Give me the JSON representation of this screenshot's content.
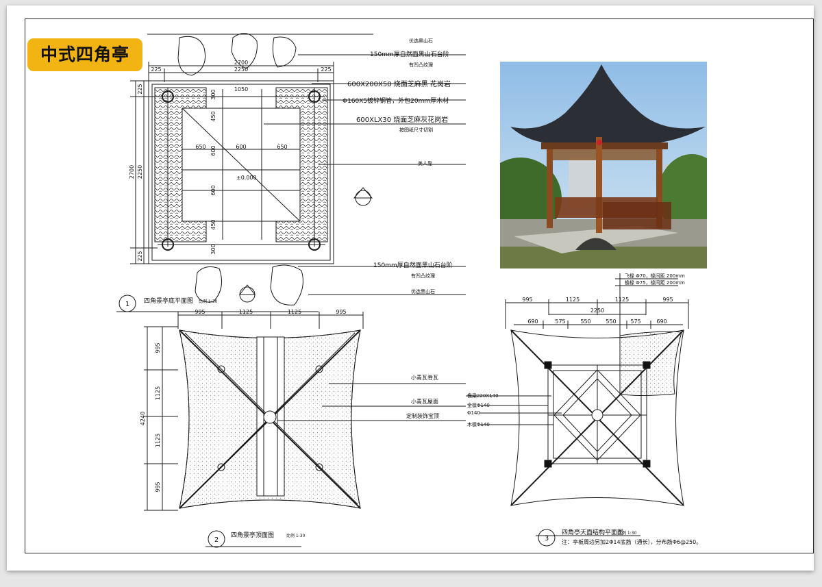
{
  "title": "中式四角亭",
  "plan1": {
    "num": "1",
    "caption": "四角景亭底平面图",
    "scale": "比例 1:30",
    "dims_top": [
      "225",
      "2250",
      "225"
    ],
    "dim_top_total": "2700",
    "dims_inner_top": [
      "1050"
    ],
    "dims_row": [
      "650",
      "600",
      "650"
    ],
    "dims_left": [
      "225",
      "2250",
      "225"
    ],
    "dim_left_total": "2700",
    "dims_vert": [
      "300",
      "450",
      "600",
      "600",
      "450",
      "300"
    ],
    "level": "±0.000",
    "notes": [
      {
        "text": "优选黑山石",
        "large": false
      },
      {
        "text": "150mm厚自然面黑山石台阶",
        "large": true
      },
      {
        "text": "有凹凸纹理",
        "large": false
      },
      {
        "text": "600X200X50 烧面芝麻黑 花岗岩",
        "large": true
      },
      {
        "text": "Φ160X5镀锌钢管，外包20mm厚木材",
        "large": true
      },
      {
        "text": "600XLX30 烧面芝麻灰花岗岩",
        "large": true
      },
      {
        "text": "按图纸尺寸切割",
        "large": false
      },
      {
        "text": "美人靠",
        "large": false
      },
      {
        "text": "150mm厚自然面黑山石台阶",
        "large": true
      },
      {
        "text": "有凹凸纹理",
        "large": false
      },
      {
        "text": "优选黑山石",
        "large": false
      }
    ]
  },
  "plan2": {
    "num": "2",
    "caption": "四角景亭顶面图",
    "scale": "比例 1:30",
    "dims_top": [
      "995",
      "1125",
      "1125",
      "995"
    ],
    "dims_left": [
      "995",
      "1125",
      "1125",
      "995"
    ],
    "dim_left_total": "4240",
    "notes": [
      "小青瓦脊瓦",
      "小青瓦屋面",
      "定制装饰宝顶"
    ]
  },
  "plan3": {
    "num": "3",
    "caption": "四角亭天面结构平面图",
    "scale": "比例 1:30",
    "note": "注：亭板周边另加2Φ14底筋（通长），分布筋Φ6@250。",
    "dims_top": [
      "995",
      "1125",
      "1125",
      "995"
    ],
    "dim_mid": "2250",
    "dims_bottom": [
      "690",
      "575",
      "550",
      "550",
      "575",
      "690"
    ],
    "spec_notes": [
      "飞椽 Φ70，椽间距 200mm",
      "檐椽 Φ75，椽间距 200mm"
    ],
    "side_notes": [
      "檐梁220X140",
      "金檩Φ140",
      "Φ140",
      "木檩Φ140"
    ]
  },
  "photo": {
    "alt_desc": "pavilion-photo"
  },
  "colors": {
    "accent": "#f2b412",
    "line": "#1a1a1a"
  }
}
